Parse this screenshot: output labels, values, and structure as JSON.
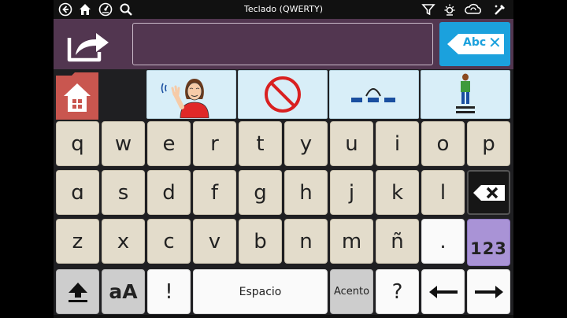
{
  "status_bar": {
    "title": "Teclado (QWERTY)",
    "icons": [
      "back-icon",
      "home-icon",
      "dashboard-icon",
      "search-icon",
      "filter-icon",
      "brightness-icon",
      "cloud-sync-icon",
      "settings-icon"
    ]
  },
  "toolbar": {
    "message_text": "",
    "clear_label": "Abc"
  },
  "quick_words": [
    {
      "icon": "person-waving-icon"
    },
    {
      "icon": "no-symbol-icon"
    },
    {
      "icon": "jump-over-icon"
    },
    {
      "icon": "person-on-podium-icon"
    }
  ],
  "keyboard": {
    "row1": [
      "q",
      "w",
      "e",
      "r",
      "t",
      "y",
      "u",
      "i",
      "o",
      "p"
    ],
    "row2": [
      "ɑ",
      "s",
      "d",
      "f",
      "g",
      "h",
      "j",
      "k",
      "l"
    ],
    "row3": [
      "z",
      "x",
      "c",
      "v",
      "b",
      "n",
      "m",
      "ñ",
      "."
    ],
    "numbers_label": "123",
    "case_label": "aA",
    "exclaim_label": "!",
    "space_label": "Espacio",
    "accent_label": "Acento",
    "question_label": "?"
  },
  "colors": {
    "toolbar_bg": "#523650",
    "key_beige": "#e3dccb",
    "word_button_bg": "#d8eef8",
    "clear_button_bg": "#1ba1dd",
    "home_button_bg": "#c9564f",
    "numbers_key_bg": "#a993d6"
  }
}
